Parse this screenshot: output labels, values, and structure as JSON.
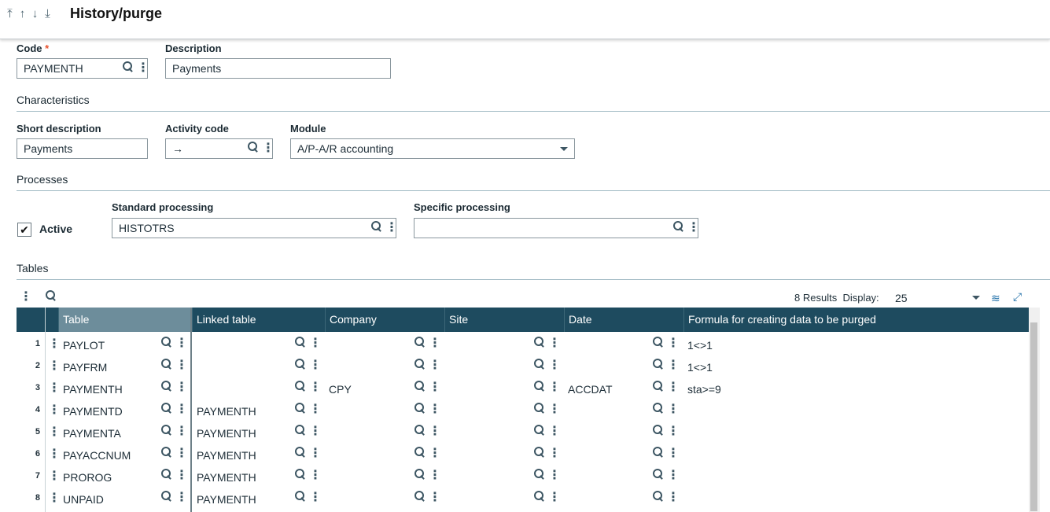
{
  "header": {
    "nav_arrows": [
      "⤒",
      "↑",
      "↓",
      "⤓"
    ],
    "title": "History/purge"
  },
  "form": {
    "code": {
      "label": "Code",
      "required_marker": "*",
      "value": "PAYMENTH"
    },
    "description": {
      "label": "Description",
      "value": "Payments"
    },
    "characteristics_title": "Characteristics",
    "short_description": {
      "label": "Short description",
      "value": "Payments"
    },
    "activity_code": {
      "label": "Activity code",
      "value": "→"
    },
    "module": {
      "label": "Module",
      "value": "A/P-A/R accounting"
    },
    "processes_title": "Processes",
    "active": {
      "label": "Active",
      "checked": true,
      "check_glyph": "✔"
    },
    "standard_processing": {
      "label": "Standard processing",
      "value": "HISTOTRS"
    },
    "specific_processing": {
      "label": "Specific processing",
      "value": ""
    }
  },
  "tables": {
    "title": "Tables",
    "results_text": "8 Results",
    "display_label": "Display:",
    "display_value": "25",
    "columns": [
      "Table",
      "Linked table",
      "Company",
      "Site",
      "Date",
      "Formula for creating data to be purged"
    ],
    "rows": [
      {
        "num": "1",
        "table": "PAYLOT",
        "linked": "",
        "company": "",
        "site": "",
        "date": "",
        "formula": "1<>1"
      },
      {
        "num": "2",
        "table": "PAYFRM",
        "linked": "",
        "company": "",
        "site": "",
        "date": "",
        "formula": "1<>1"
      },
      {
        "num": "3",
        "table": "PAYMENTH",
        "linked": "",
        "company": "CPY",
        "site": "",
        "date": "ACCDAT",
        "formula": "sta>=9"
      },
      {
        "num": "4",
        "table": "PAYMENTD",
        "linked": "PAYMENTH",
        "company": "",
        "site": "",
        "date": "",
        "formula": ""
      },
      {
        "num": "5",
        "table": "PAYMENTA",
        "linked": "PAYMENTH",
        "company": "",
        "site": "",
        "date": "",
        "formula": ""
      },
      {
        "num": "6",
        "table": "PAYACCNUM",
        "linked": "PAYMENTH",
        "company": "",
        "site": "",
        "date": "",
        "formula": ""
      },
      {
        "num": "7",
        "table": "PROROG",
        "linked": "PAYMENTH",
        "company": "",
        "site": "",
        "date": "",
        "formula": ""
      },
      {
        "num": "8",
        "table": "UNPAID",
        "linked": "PAYMENTH",
        "company": "",
        "site": "",
        "date": "",
        "formula": ""
      }
    ]
  },
  "colors": {
    "grid_header": "#1e4b5f",
    "grid_header_selected": "#6d8d9b",
    "required": "#e8522f",
    "link_icon": "#1f6fa8"
  }
}
